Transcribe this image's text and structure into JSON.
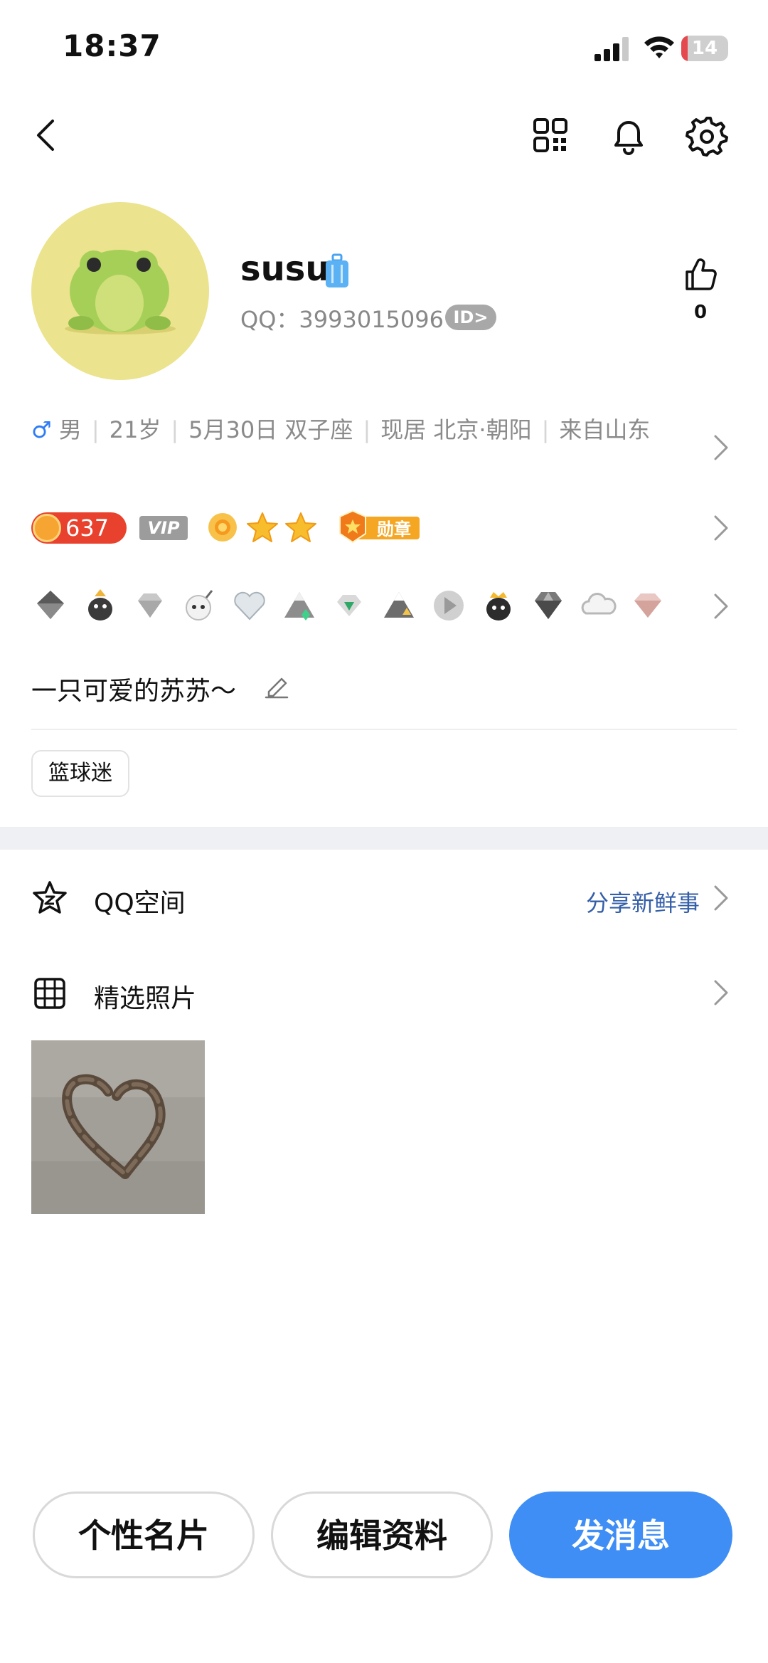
{
  "status_bar": {
    "time": "18:37",
    "battery": "14",
    "battery_level": 0.14
  },
  "header": {
    "icons": [
      "back-icon",
      "qr-code-icon",
      "bell-icon",
      "gear-icon"
    ]
  },
  "profile": {
    "nickname": "susu",
    "qq_label": "QQ：",
    "qq_number": "3993015096",
    "id_badge": "ID>",
    "like_count": "0"
  },
  "info": {
    "gender_symbol": "♂",
    "gender": "男",
    "age": "21岁",
    "birthday": "5月30日 双子座",
    "residence": "现居 北京·朝阳",
    "hometown": "来自山东"
  },
  "level": {
    "score": "637",
    "vip": "VIP",
    "medal": "勋章"
  },
  "signature": "一只可爱的苏苏～",
  "tags": [
    "篮球迷"
  ],
  "qq_space": {
    "label": "QQ空间",
    "action": "分享新鲜事"
  },
  "photos": {
    "label": "精选照片"
  },
  "buttons": {
    "card": "个性名片",
    "edit": "编辑资料",
    "message": "发消息"
  },
  "colors": {
    "accent": "#3f8ef5",
    "male": "#2e7cf6",
    "link": "#345ea8",
    "level": "#e8412d",
    "avatar_bg": "#ebe38d"
  }
}
